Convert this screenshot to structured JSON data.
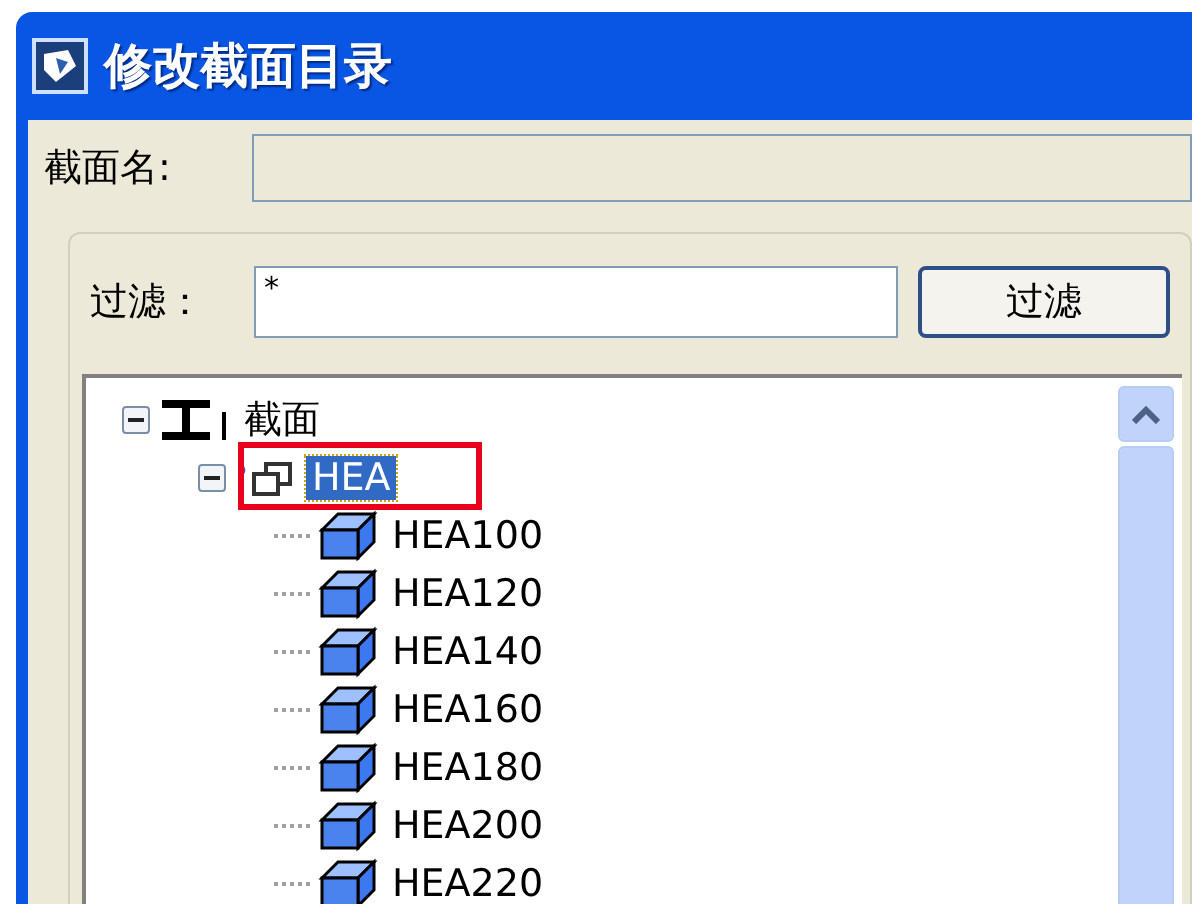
{
  "window": {
    "title": "修改截面目录"
  },
  "section_name": {
    "label": "截面名:"
  },
  "filter": {
    "label": "过滤：",
    "value": "*",
    "button": "过滤"
  },
  "tree": [
    {
      "label": "截面",
      "kind": "root",
      "expanded": true,
      "selected": false,
      "children": [
        {
          "label": "HEA",
          "kind": "group",
          "expanded": true,
          "selected": true,
          "children": [
            {
              "label": "HEA100",
              "kind": "section",
              "selected": false
            },
            {
              "label": "HEA120",
              "kind": "section",
              "selected": false
            },
            {
              "label": "HEA140",
              "kind": "section",
              "selected": false
            },
            {
              "label": "HEA160",
              "kind": "section",
              "selected": false
            },
            {
              "label": "HEA180",
              "kind": "section",
              "selected": false
            },
            {
              "label": "HEA200",
              "kind": "section",
              "selected": false
            },
            {
              "label": "HEA220",
              "kind": "section",
              "selected": false
            }
          ]
        }
      ]
    }
  ]
}
